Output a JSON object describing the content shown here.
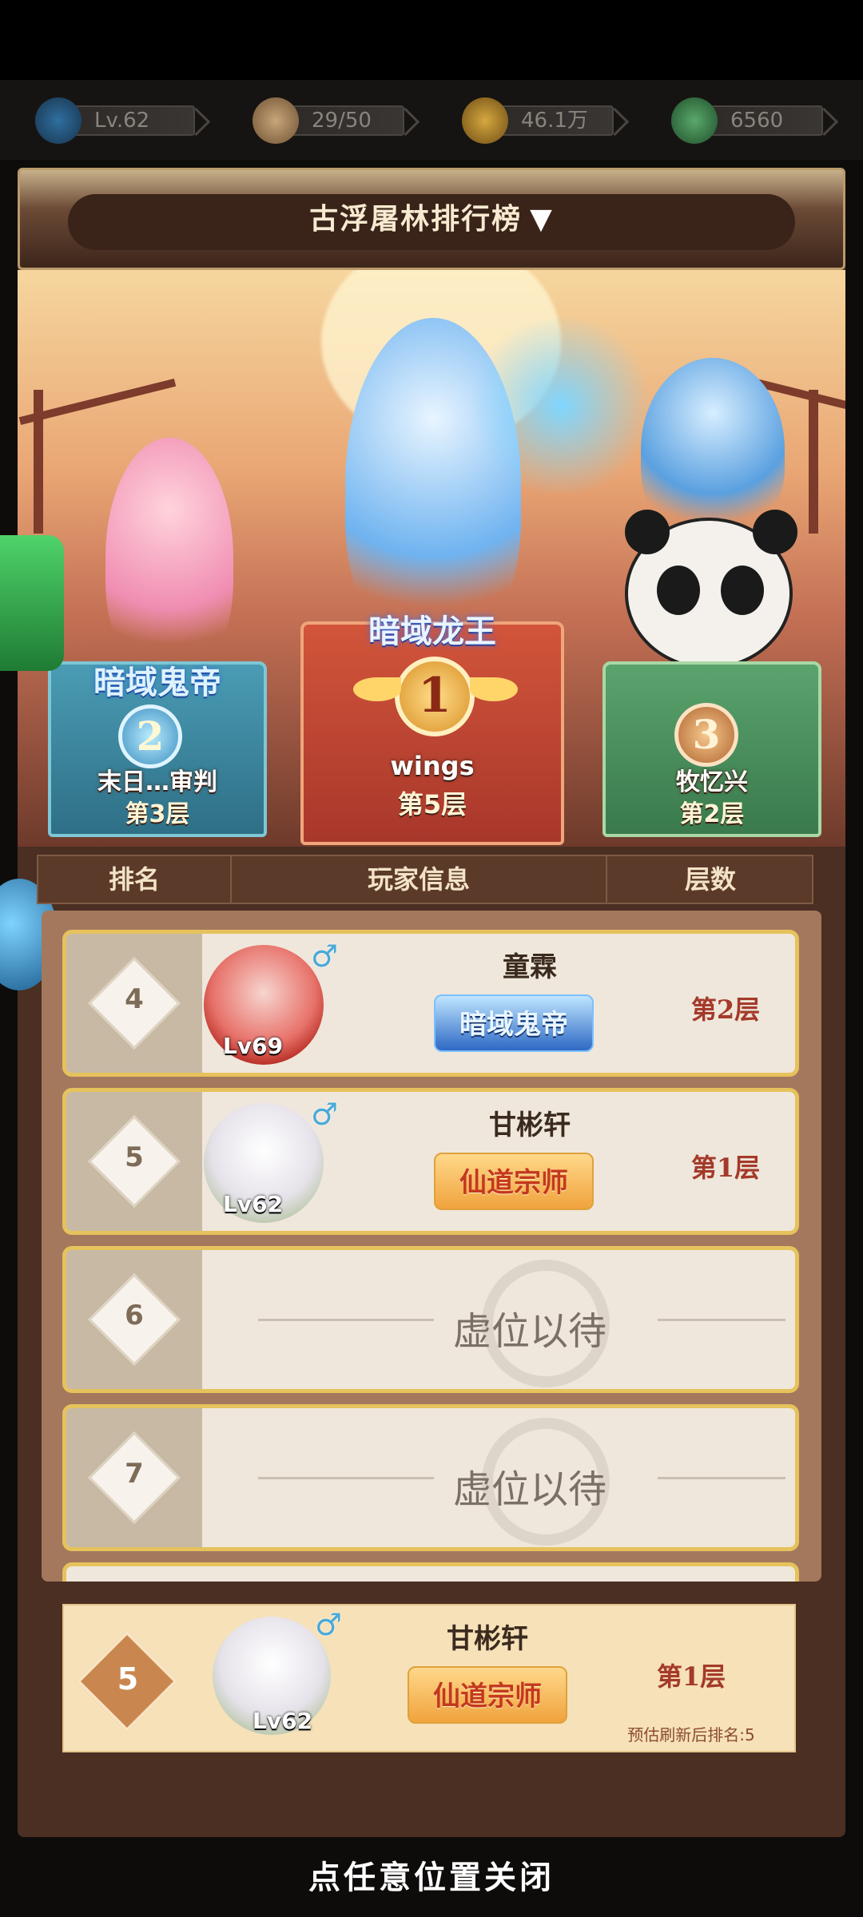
{
  "resources": [
    {
      "icon": "level-icon",
      "value": "Lv.62"
    },
    {
      "icon": "stamina-bun-icon",
      "value": "29/50"
    },
    {
      "icon": "copper-coin-icon",
      "value": "46.1万"
    },
    {
      "icon": "jade-leaf-icon",
      "value": "6560"
    }
  ],
  "panel": {
    "title": "古浮屠林排行榜",
    "dropdown_glyph": "▼"
  },
  "podium": {
    "first": {
      "rank": "1",
      "title_badge": "暗域龙王",
      "name": "wings",
      "floor": "第5层"
    },
    "second": {
      "rank": "2",
      "title_badge": "暗域鬼帝",
      "name": "末日…审判",
      "floor": "第3层"
    },
    "third": {
      "rank": "3",
      "name": "牧忆兴",
      "floor": "第2层"
    }
  },
  "table_header": {
    "rank": "排名",
    "player": "玩家信息",
    "floor": "层数"
  },
  "rows": [
    {
      "rank": "4",
      "name": "童霖",
      "level": "Lv69",
      "gender": "♂",
      "badge": "暗域鬼帝",
      "floor": "第2层"
    },
    {
      "rank": "5",
      "name": "甘彬轩",
      "level": "Lv62",
      "gender": "♂",
      "badge": "仙道宗师",
      "floor": "第1层"
    },
    {
      "rank": "6",
      "vacant": "虚位以待"
    },
    {
      "rank": "7",
      "vacant": "虚位以待"
    }
  ],
  "my_rank": {
    "rank": "5",
    "name": "甘彬轩",
    "level": "Lv62",
    "gender": "♂",
    "badge": "仙道宗师",
    "floor": "第1层",
    "estimate": "预估刷新后排名:5"
  },
  "close_hint": "点任意位置关闭",
  "colors": {
    "accent_gold": "#e6c25c",
    "floor_red": "#a43a2a",
    "panel_brown": "#4a2f22"
  }
}
